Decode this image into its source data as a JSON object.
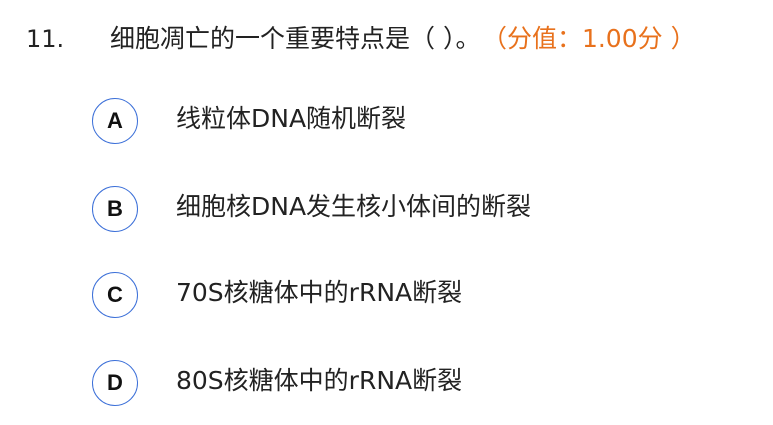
{
  "question": {
    "number": "11.",
    "text": "细胞凋亡的一个重要特点是（ ）。",
    "score": "（分值：1.00分 ）"
  },
  "options": [
    {
      "letter": "A",
      "text": "线粒体DNA随机断裂"
    },
    {
      "letter": "B",
      "text": "细胞核DNA发生核小体间的断裂"
    },
    {
      "letter": "C",
      "text": "70S核糖体中的rRNA断裂"
    },
    {
      "letter": "D",
      "text": "80S核糖体中的rRNA断裂"
    }
  ],
  "colors": {
    "score": "#e8711c",
    "option_border": "#3b6fd8",
    "text": "#222222"
  }
}
